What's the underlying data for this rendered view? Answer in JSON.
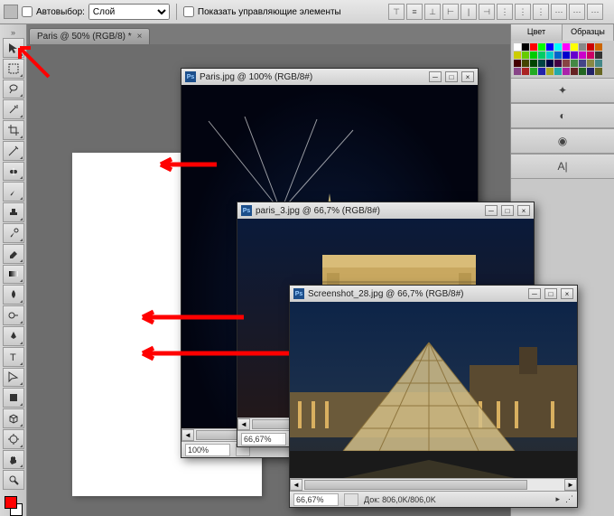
{
  "options": {
    "autoselect_label": "Автовыбор:",
    "autoselect_dropdown": "Слой",
    "show_controls_label": "Показать управляющие элементы"
  },
  "main_tab": {
    "label": "Paris @ 50% (RGB/8) *"
  },
  "tools": [
    "move",
    "marquee",
    "lasso",
    "wand",
    "crop",
    "eyedropper",
    "healing",
    "brush",
    "stamp",
    "history",
    "eraser",
    "gradient",
    "blur",
    "dodge",
    "pen",
    "type",
    "path",
    "rect",
    "notes",
    "hand",
    "zoom",
    "3d",
    "3dcam"
  ],
  "right": {
    "tab_color": "Цвет",
    "tab_swatches": "Образцы",
    "swatch_colors": [
      "#fff",
      "#000",
      "#f00",
      "#0f0",
      "#00f",
      "#0ff",
      "#f0f",
      "#ff0",
      "#888",
      "#c00",
      "#c60",
      "#cc0",
      "#6c0",
      "#0c0",
      "#0c6",
      "#0cc",
      "#06c",
      "#00c",
      "#60c",
      "#c0c",
      "#c06",
      "#333",
      "#400",
      "#440",
      "#040",
      "#044",
      "#004",
      "#404",
      "#844",
      "#484",
      "#448",
      "#884",
      "#488",
      "#848",
      "#a22",
      "#2a2",
      "#22a",
      "#aa2",
      "#2aa",
      "#a2a",
      "#622",
      "#262",
      "#226",
      "#662"
    ],
    "char_panel_icon": "A|"
  },
  "windows": {
    "w1": {
      "title": "Paris.jpg @ 100% (RGB/8#)",
      "zoom": "100%"
    },
    "w2": {
      "title": "paris_3.jpg @ 66,7% (RGB/8#)",
      "zoom": "66,67%"
    },
    "w3": {
      "title": "Screenshot_28.jpg @ 66,7% (RGB/8#)",
      "zoom": "66,67%",
      "doc_info": "Док: 806,0K/806,0K"
    }
  }
}
